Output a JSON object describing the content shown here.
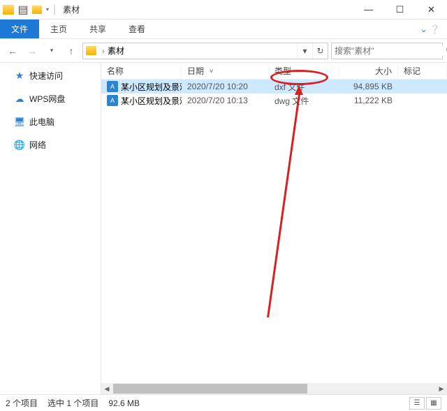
{
  "window": {
    "title": "素材",
    "min": "—",
    "max": "☐",
    "close": "✕"
  },
  "ribbon": {
    "file": "文件",
    "home": "主页",
    "share": "共享",
    "view": "查看"
  },
  "nav": {
    "back": "←",
    "forward": "→",
    "up": "↑",
    "recent_caret": "▾",
    "breadcrumb_sep": "›",
    "breadcrumb_item": "素材",
    "refresh": "↻",
    "dropdown": "▾"
  },
  "search": {
    "placeholder": "搜索\"素材\"",
    "icon": "🔍"
  },
  "sidebar": {
    "items": [
      {
        "label": "快速访问",
        "icon": "★"
      },
      {
        "label": "WPS网盘",
        "icon": "☁"
      },
      {
        "label": "此电脑",
        "icon": "🖥"
      },
      {
        "label": "网络",
        "icon": "🌐"
      }
    ]
  },
  "columns": {
    "name": "名称",
    "date": "日期",
    "type": "类型",
    "size": "大小",
    "tag": "标记"
  },
  "files": [
    {
      "icon": "A",
      "name": "某小区规划及景观...",
      "date": "2020/7/20 10:20",
      "type": "dxf 文件",
      "size": "94,895 KB",
      "selected": true
    },
    {
      "icon": "A",
      "name": "某小区规划及景观...",
      "date": "2020/7/20 10:13",
      "type": "dwg 文件",
      "size": "11,222 KB",
      "selected": false
    }
  ],
  "status": {
    "count": "2 个项目",
    "selection": "选中 1 个项目",
    "size": "92.6 MB"
  }
}
